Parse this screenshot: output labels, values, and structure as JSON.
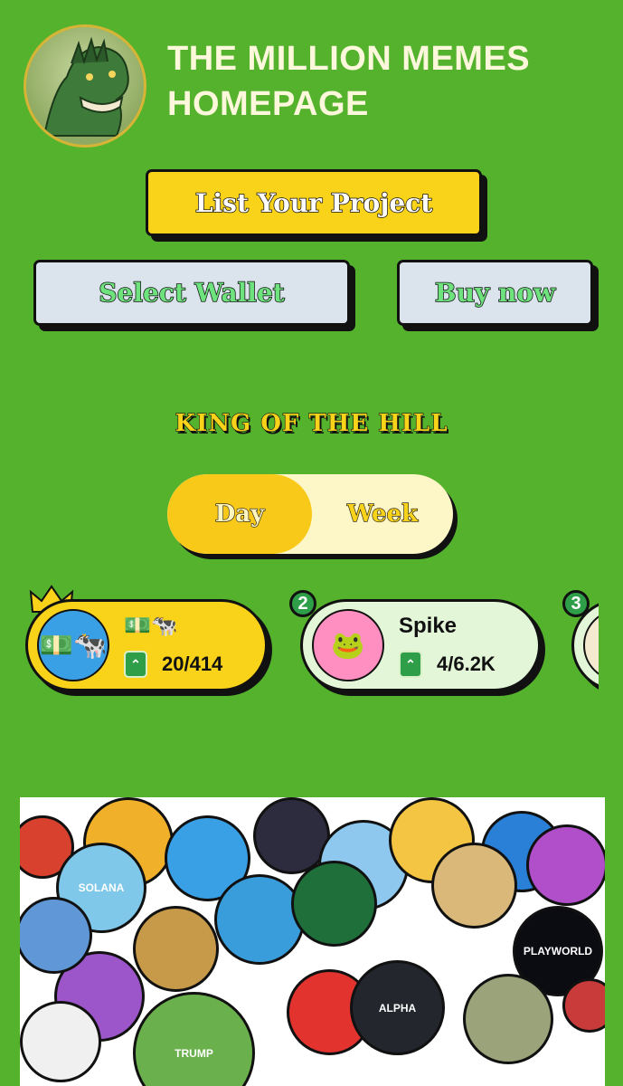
{
  "header": {
    "title_line1": "THE MILLION MEMES",
    "title_line2": "HOMEPAGE"
  },
  "actions": {
    "list_project": "List Your Project",
    "select_wallet": "Select Wallet",
    "buy_now": "Buy now"
  },
  "king_of_the_hill": {
    "heading": "KING OF THE HILL",
    "toggle": {
      "day": "Day",
      "week": "Week",
      "selected": "Day"
    }
  },
  "leaders": [
    {
      "rank": "1",
      "avatar": "💵🐄",
      "name": "💵🐄",
      "stat": "20/414"
    },
    {
      "rank": "2",
      "avatar": "🐸",
      "name": "Spike",
      "stat": "4/6.2K"
    },
    {
      "rank": "3",
      "avatar": "",
      "name": "",
      "stat": ""
    }
  ],
  "bubbles": [
    {
      "color": "#d9412f",
      "label": ""
    },
    {
      "color": "#f0b02a",
      "label": ""
    },
    {
      "color": "#3aa0e6",
      "label": ""
    },
    {
      "color": "#2c2c3e",
      "label": ""
    },
    {
      "color": "#8ec8ee",
      "label": ""
    },
    {
      "color": "#f4c542",
      "label": ""
    },
    {
      "color": "#2a7fd6",
      "label": ""
    },
    {
      "color": "#b04fc9",
      "label": ""
    },
    {
      "color": "#7fc8ea",
      "label": "SOLANA"
    },
    {
      "color": "#c79a4a",
      "label": ""
    },
    {
      "color": "#3a9ddb",
      "label": ""
    },
    {
      "color": "#0b0b12",
      "label": "PLAYWORLD"
    },
    {
      "color": "#9c56c9",
      "label": ""
    },
    {
      "color": "#e2332f",
      "label": ""
    },
    {
      "color": "#5f97d7",
      "label": ""
    },
    {
      "color": "#23262d",
      "label": "ALPHA"
    },
    {
      "color": "#9aa37a",
      "label": ""
    },
    {
      "color": "#6ab04c",
      "label": "TRUMP"
    },
    {
      "color": "#d9b87a",
      "label": ""
    },
    {
      "color": "#1f6f3b",
      "label": ""
    },
    {
      "color": "#f0f0f0",
      "label": ""
    },
    {
      "color": "#c93b3b",
      "label": ""
    }
  ]
}
